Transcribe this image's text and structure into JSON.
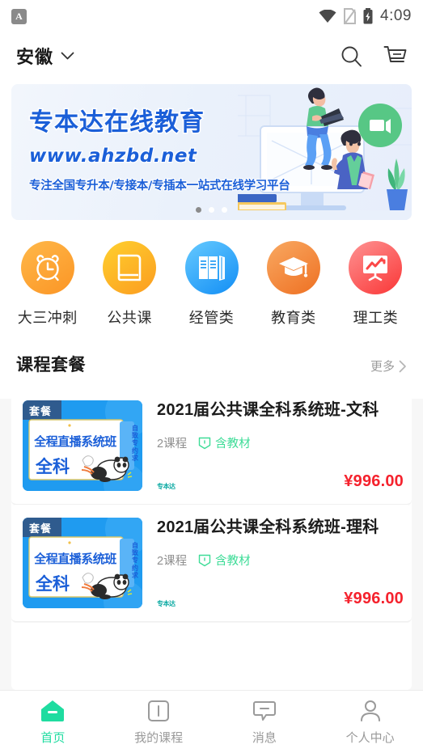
{
  "status_bar": {
    "app_icon_letter": "A",
    "icons": [
      "wifi-icon",
      "no-sim-icon",
      "battery-charging-icon"
    ],
    "time": "4:09"
  },
  "header": {
    "city": "安徽",
    "chevron": "chevron-down-icon",
    "search_icon": "search-icon",
    "cart_icon": "cart-icon"
  },
  "banner": {
    "line1": "专本达在线教育",
    "line2": "www.ahzbd.net",
    "line3": "专注全国专升本/专接本/专插本一站式在线学习平台",
    "brand_color": "#1b5fd8",
    "video_badge": "video-icon",
    "dots": 3,
    "active_dot": 0
  },
  "categories": [
    {
      "label": "大三冲刺",
      "icon": "alarm-clock-icon",
      "color_from": "#ffb23f",
      "color_to": "#fb9a2b"
    },
    {
      "label": "公共课",
      "icon": "book-icon",
      "color_from": "#ffcd2e",
      "color_to": "#fb9e23"
    },
    {
      "label": "经管类",
      "icon": "books-icon",
      "color_from": "#5ec7fb",
      "color_to": "#1494f7"
    },
    {
      "label": "教育类",
      "icon": "graduation-cap-icon",
      "color_from": "#f8a35a",
      "color_to": "#ef7326"
    },
    {
      "label": "理工类",
      "icon": "chart-board-icon",
      "color_from": "#fd8a8a",
      "color_to": "#fb3b3b"
    }
  ],
  "section": {
    "title": "课程套餐",
    "more_label": "更多",
    "more_icon": "chevron-right-icon"
  },
  "courses": [
    {
      "title": "2021届公共课全科系统班-文科",
      "lesson_count": "2课程",
      "tag": "含教材",
      "tag_icon": "textbook-icon",
      "brand": "专本达",
      "price": "¥996.00",
      "thumb": {
        "badge": "套餐",
        "headline": "全程直播系统班",
        "subline": "全科",
        "side_text": "自致专约求"
      }
    },
    {
      "title": "2021届公共课全科系统班-理科",
      "lesson_count": "2课程",
      "tag": "含教材",
      "tag_icon": "textbook-icon",
      "brand": "专本达",
      "price": "¥996.00",
      "thumb": {
        "badge": "套餐",
        "headline": "全程直播系统班",
        "subline": "全科",
        "side_text": "自致专约求"
      }
    }
  ],
  "tabbar": {
    "active_color": "#1fdca0",
    "items": [
      {
        "label": "首页",
        "icon": "home-icon",
        "active": true
      },
      {
        "label": "我的课程",
        "icon": "courses-icon",
        "active": false
      },
      {
        "label": "消息",
        "icon": "message-icon",
        "active": false
      },
      {
        "label": "个人中心",
        "icon": "profile-icon",
        "active": false
      }
    ]
  }
}
